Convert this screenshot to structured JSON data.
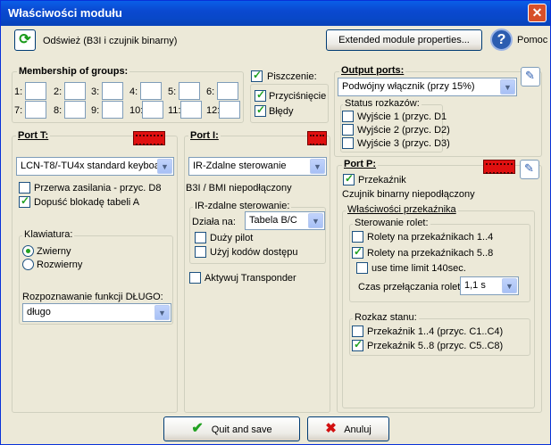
{
  "window": {
    "title": "Właściwości modułu"
  },
  "toolbar": {
    "refresh_label": "Odśwież (B3I i czujnik binarny)",
    "extended_label": "Extended module properties...",
    "help_label": "Pomoc"
  },
  "groups": {
    "title": "Membership of groups:",
    "labels": [
      "1:",
      "2:",
      "3:",
      "4:",
      "5:",
      "6:",
      "7:",
      "8:",
      "9:",
      "10:",
      "11:",
      "12:"
    ]
  },
  "beep": {
    "label": "Piszczenie:",
    "press": "Przyciśnięcie",
    "errors": "Błędy"
  },
  "output": {
    "title": "Output ports:",
    "select": "Podwójny włącznik (przy 15%)",
    "status_title": "Status rozkazów:",
    "outputs": [
      "Wyjście 1 (przyc. D1",
      "Wyjście 2 (przyc. D2)",
      "Wyjście 3 (przyc. D3)"
    ]
  },
  "portT": {
    "title": "Port T:",
    "select": "LCN-T8/-TU4x standard keyboa",
    "power_fail": "Przerwa zasilania - przyc. D8",
    "allow_block": "Dopuść blokadę tabeli A",
    "keyboard_title": "Klawiatura:",
    "normally_open": "Zwierny",
    "normally_closed": "Rozwierny",
    "long_title": "Rozpoznawanie funkcji DŁUGO:",
    "long_select": "długo"
  },
  "portI": {
    "title": "Port I:",
    "select": "IR-Zdalne sterowanie",
    "status": "B3I / BMI niepodłączony",
    "ir_title": "IR-zdalne sterowanie:",
    "acts_on": "Działa na:",
    "acts_select": "Tabela B/C",
    "big_remote": "Duży pilot",
    "access_codes": "Użyj kodów dostępu",
    "transponder": "Aktywuj Transponder"
  },
  "portP": {
    "title": "Port P:",
    "relay": "Przekaźnik",
    "status": "Czujnik binarny niepodłączony",
    "relay_props": "Właściwości przekaźnika",
    "shutter_title": "Sterowanie rolet:",
    "shutters_1_4": "Rolety na przekaźnikach 1..4",
    "shutters_5_8": "Rolety na przekaźnikach 5..8",
    "time_limit": "use time limit 140sec.",
    "switch_time": "Czas przełączania rolet:",
    "switch_select": "1,1 s",
    "state_title": "Rozkaz stanu:",
    "relay_1_4": "Przekaźnik 1..4 (przyc. C1..C4)",
    "relay_5_8": "Przekaźnik 5..8 (przyc. C5..C8)"
  },
  "footer": {
    "ok_label": "Quit and save",
    "cancel_label": "Anuluj"
  },
  "colors": {
    "title_bar": "#0A49D0",
    "check": "#21A121",
    "window_bg": "#ECE9D8"
  }
}
